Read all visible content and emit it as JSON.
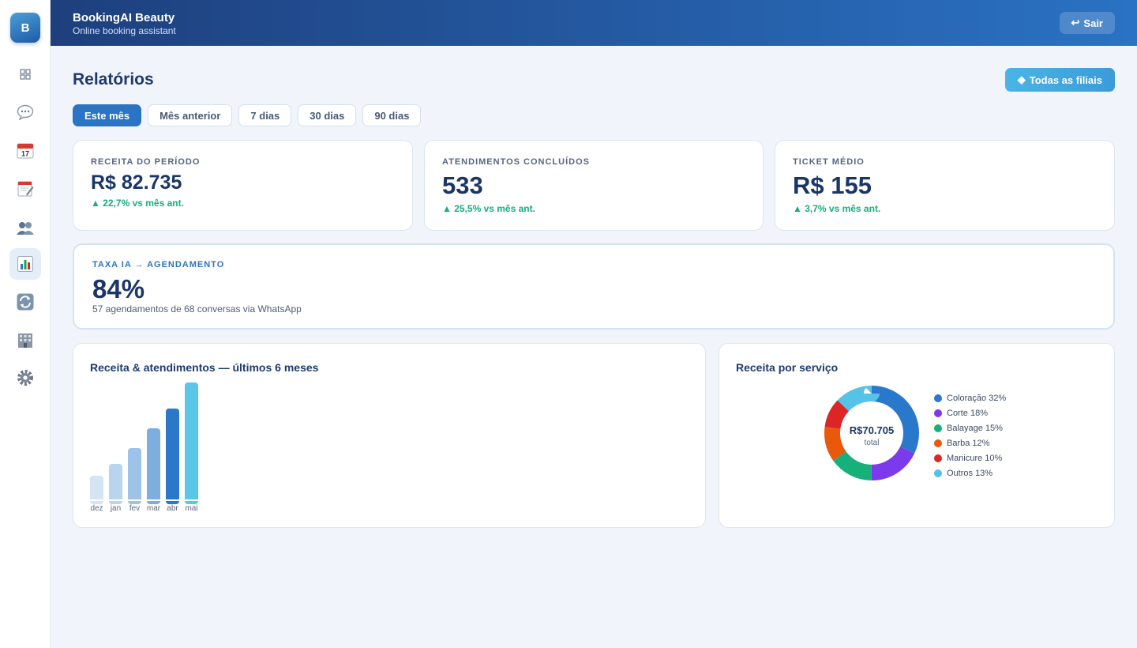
{
  "app": {
    "logo_letter": "B",
    "title": "BookingAI Beauty",
    "subtitle": "Online booking assistant"
  },
  "header": {
    "logout_icon": "↩",
    "logout_label": "Sair"
  },
  "sidebar": {
    "items": [
      {
        "name": "dashboard",
        "icon": "grid-icon"
      },
      {
        "name": "conversations",
        "icon": "chat-bubble-icon"
      },
      {
        "name": "calendar",
        "icon": "calendar-icon"
      },
      {
        "name": "appointments",
        "icon": "notepad-icon"
      },
      {
        "name": "clients",
        "icon": "users-icon"
      },
      {
        "name": "reports",
        "icon": "bar-chart-icon",
        "active": true
      },
      {
        "name": "sync",
        "icon": "refresh-icon"
      },
      {
        "name": "branches",
        "icon": "building-icon"
      },
      {
        "name": "settings",
        "icon": "gear-icon"
      }
    ]
  },
  "page": {
    "title": "Relatórios",
    "branch_button": {
      "icon": "◆",
      "label": "Todas as filiais"
    },
    "filters": [
      "Este mês",
      "Mês anterior",
      "7 dias",
      "30 dias",
      "90 dias"
    ],
    "active_filter": 0
  },
  "kpis": [
    {
      "label": "Receita do período",
      "value": "R$ 82.735",
      "delta": "▲ 22,7% vs mês ant."
    },
    {
      "label": "Atendimentos concluídos",
      "value": "533",
      "delta": "▲ 25,5% vs mês ant."
    },
    {
      "label": "Ticket médio",
      "value": "R$ 155",
      "delta": "▲ 3,7% vs mês ant."
    }
  ],
  "ia_conversion": {
    "label": "TAXA IA → AGENDAMENTO",
    "value": "84%",
    "note": "57 agendamentos de 68 conversas via WhatsApp"
  },
  "colors": {
    "accent": "#2b73c3",
    "positive": "#16b07a",
    "header_start": "#1e3f7d",
    "header_end": "#2a72c4"
  },
  "chart_data": [
    {
      "type": "bar",
      "title": "Receita & atendimentos — últimos 6 meses",
      "categories": [
        "dez",
        "jan",
        "fev",
        "mar",
        "abr",
        "mai"
      ],
      "values": [
        30,
        45,
        65,
        90,
        115,
        148
      ],
      "colors": [
        "#d4e4f5",
        "#b9d4ef",
        "#9ec2e8",
        "#7daee0",
        "#2b78c9",
        "#5bc7e8"
      ],
      "grid": false
    },
    {
      "type": "pie",
      "title": "Receita por serviço",
      "center_value": "R$70.705",
      "center_label": "total",
      "slices": [
        {
          "label": "Coloração 32%",
          "value": 32,
          "color": "#2a78cc"
        },
        {
          "label": "Corte 18%",
          "value": 18,
          "color": "#7c3aed"
        },
        {
          "label": "Balayage 15%",
          "value": 15,
          "color": "#16b07a"
        },
        {
          "label": "Barba 12%",
          "value": 12,
          "color": "#ea580c"
        },
        {
          "label": "Manicure 10%",
          "value": 10,
          "color": "#dc2626"
        },
        {
          "label": "Outros 13%",
          "value": 13,
          "color": "#56c2e6"
        }
      ],
      "legend": "right"
    }
  ]
}
